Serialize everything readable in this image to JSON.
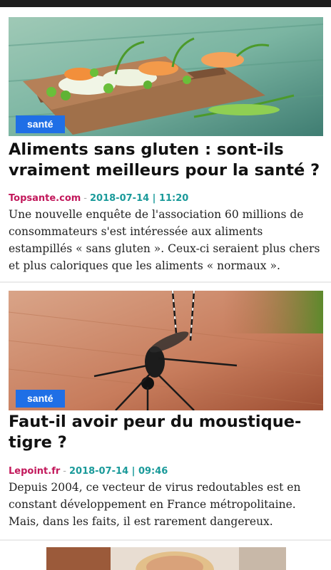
{
  "articles": [
    {
      "category": "santé",
      "title": "Aliments sans gluten : sont-ils vraiment meilleurs pour la santé ?",
      "source": "Topsante.com",
      "separator": "-",
      "date": "2018-07-14 | 11:20",
      "excerpt": "Une nouvelle enquête de l'association 60 millions de consommateurs s'est intéressée aux aliments estampillés « sans gluten ». Ceux-ci seraient plus chers et plus caloriques que les aliments « normaux »."
    },
    {
      "category": "santé",
      "title": "Faut-il avoir peur du moustique-tigre ?",
      "source": "Lepoint.fr",
      "separator": "-",
      "date": "2018-07-14 | 09:46",
      "excerpt": "Depuis 2004, ce vecteur de virus redoutables est en constant développement en France métropolitaine. Mais, dans les faits, il est rarement dangereux."
    }
  ],
  "colors": {
    "badge": "#1f6fe6",
    "source": "#c2185b",
    "date": "#1a9a9a"
  }
}
